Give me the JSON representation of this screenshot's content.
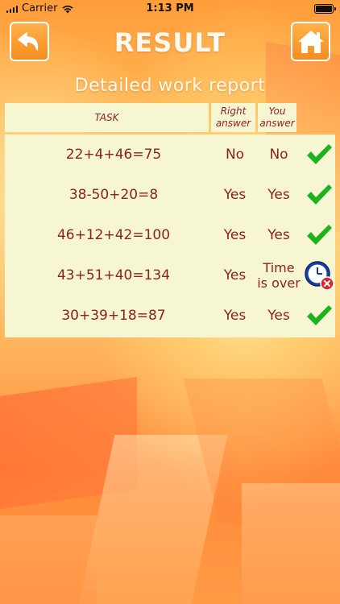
{
  "status_bar": {
    "carrier": "Carrier",
    "time": "1:13 PM"
  },
  "header": {
    "title": "RESULT",
    "subtitle": "Detailed work report",
    "back_icon": "back-arrow-icon",
    "home_icon": "home-icon"
  },
  "table": {
    "columns": {
      "task": "TASK",
      "right_answer": "Right answer",
      "you_answer": "You answer"
    },
    "rows": [
      {
        "task": "22+4+46=75",
        "right_answer": "No",
        "you_answer": "No",
        "status": "correct"
      },
      {
        "task": "38-50+20=8",
        "right_answer": "Yes",
        "you_answer": "Yes",
        "status": "correct"
      },
      {
        "task": "46+12+42=100",
        "right_answer": "Yes",
        "you_answer": "Yes",
        "status": "correct"
      },
      {
        "task": "43+51+40=134",
        "right_answer": "Yes",
        "you_answer": "Time is over",
        "status": "timeout"
      },
      {
        "task": "30+39+18=87",
        "right_answer": "Yes",
        "you_answer": "Yes",
        "status": "correct"
      }
    ]
  },
  "colors": {
    "accent": "#f58d1f",
    "table_bg": "#f7f6d3",
    "table_text": "#8a1f1f",
    "check_green": "#1db31d",
    "timer_blue": "#1a3fa0",
    "error_red": "#e0242a"
  }
}
